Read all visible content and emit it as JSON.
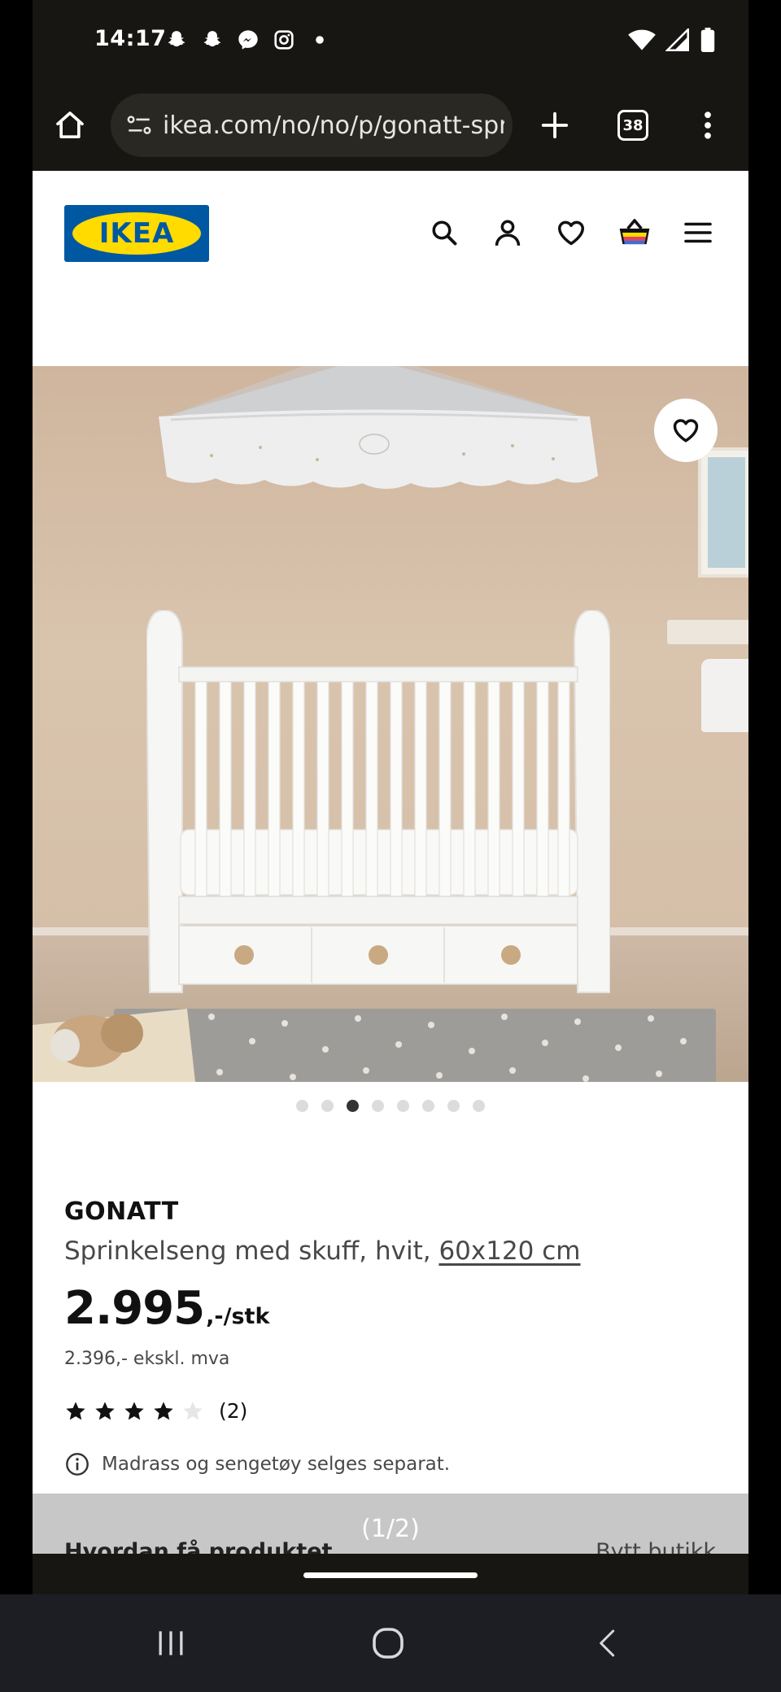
{
  "status_bar": {
    "time": "14:17",
    "notification_icons": [
      "snapchat-icon",
      "snapchat-icon",
      "messenger-icon",
      "instagram-icon",
      "dot-icon"
    ],
    "system_icons": [
      "wifi-icon",
      "signal-icon",
      "battery-icon"
    ]
  },
  "browser": {
    "url": "ikea.com/no/no/p/gonatt-spr",
    "tab_count": "38"
  },
  "header": {
    "logo_text": "IKEA",
    "icons": [
      "search-icon",
      "user-icon",
      "heart-icon",
      "basket-icon",
      "menu-icon"
    ]
  },
  "gallery": {
    "total_images": 8,
    "active_index": 2
  },
  "product": {
    "name": "GONATT",
    "description": "Sprinkelseng med skuff, hvit,",
    "size": "60x120 cm",
    "price": "2.995",
    "price_suffix": ",-/stk",
    "price_ex_vat": "2.396,- ekskl. mva",
    "rating": 4,
    "rating_max": 5,
    "review_count": "(2)",
    "notice": "Madrass og sengetøy selges separat."
  },
  "section": {
    "counter": "(1/2)",
    "how_to_get": "Hvordan få produktet",
    "change_store": "Bytt butikk"
  },
  "colors": {
    "ikea_blue": "#0058a3",
    "ikea_yellow": "#ffdb00",
    "browser_bg": "#181613"
  }
}
